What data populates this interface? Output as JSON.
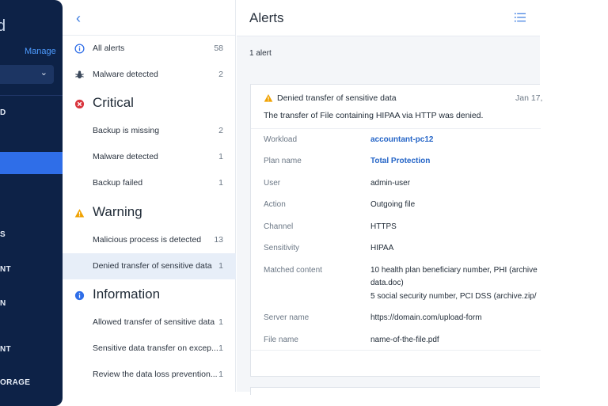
{
  "nav": {
    "logo_partial": "d",
    "manage": "Manage",
    "items": [
      {
        "label": "D"
      },
      {
        "label": "S"
      },
      {
        "label": "NT"
      },
      {
        "label": "N"
      },
      {
        "label": "NT"
      },
      {
        "label": "ORAGE"
      }
    ]
  },
  "list": {
    "all": {
      "label": "All alerts",
      "count": "58"
    },
    "malware": {
      "label": "Malware detected",
      "count": "2"
    },
    "critical": {
      "title": "Critical",
      "items": [
        {
          "label": "Backup is missing",
          "count": "2"
        },
        {
          "label": "Malware detected",
          "count": "1"
        },
        {
          "label": "Backup failed",
          "count": "1"
        }
      ]
    },
    "warning": {
      "title": "Warning",
      "items": [
        {
          "label": "Malicious process is detected",
          "count": "13"
        },
        {
          "label": "Denied transfer of sensitive data",
          "count": "1"
        }
      ]
    },
    "information": {
      "title": "Information",
      "items": [
        {
          "label": "Allowed transfer of sensitive data",
          "count": "1"
        },
        {
          "label": "Sensitive data transfer on excep...",
          "count": "1"
        },
        {
          "label": "Review the data loss prevention...",
          "count": "1"
        }
      ]
    }
  },
  "detail": {
    "title": "Alerts",
    "count_line": "1 alert",
    "card": {
      "title": "Denied transfer of sensitive data",
      "date": "Jan 17,",
      "description": "The transfer of File containing HIPAA via HTTP was denied.",
      "fields": {
        "workload": {
          "key": "Workload",
          "value": "accountant-pc12"
        },
        "plan": {
          "key": "Plan name",
          "value": "Total Protection"
        },
        "user": {
          "key": "User",
          "value": "admin-user"
        },
        "action": {
          "key": "Action",
          "value": "Outgoing file"
        },
        "channel": {
          "key": "Channel",
          "value": "HTTPS"
        },
        "sensitivity": {
          "key": "Sensitivity",
          "value": "HIPAA"
        },
        "matched": {
          "key": "Matched content",
          "line1": "10 health plan beneficiary number, PHI (archive",
          "line2": "data.doc)",
          "line3": "5 social security number, PCI DSS (archive.zip/"
        },
        "server": {
          "key": "Server name",
          "value": "https://domain.com/upload-form"
        },
        "file": {
          "key": "File name",
          "value": "name-of-the-file.pdf"
        }
      }
    }
  },
  "colors": {
    "nav_bg": "#0d2247",
    "accent": "#2f6ee8",
    "link": "#2565c7",
    "critical": "#d9363e",
    "warning": "#f0a202",
    "info": "#2f6ee8"
  }
}
